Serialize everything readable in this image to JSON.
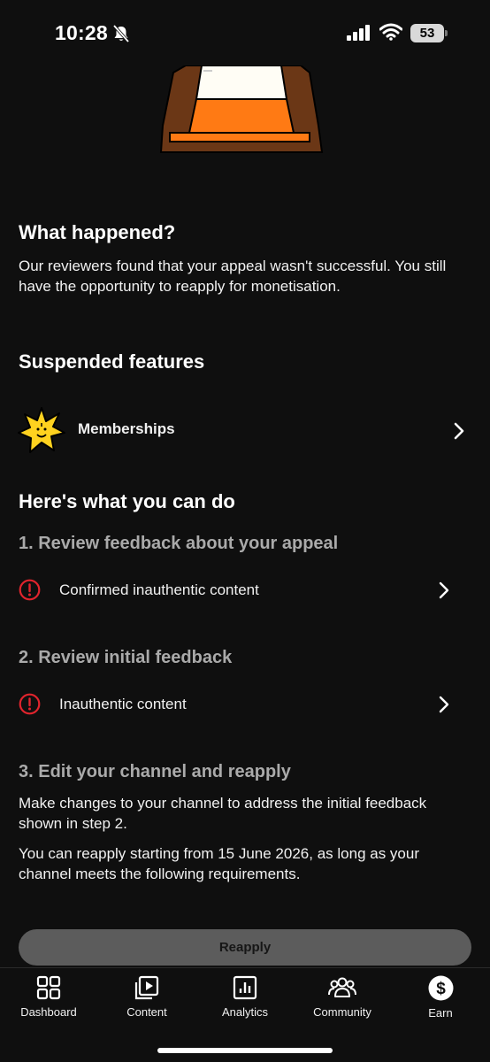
{
  "status_bar": {
    "time": "10:28",
    "battery": "53"
  },
  "what_happened": {
    "heading": "What happened?",
    "body": "Our reviewers found that your appeal wasn't successful. You still have the opportunity to reapply for monetisation."
  },
  "suspended": {
    "heading": "Suspended features",
    "items": [
      {
        "label": "Memberships"
      }
    ]
  },
  "what_you_can_do": {
    "heading": "Here's what you can do",
    "step1": {
      "title": "1. Review feedback about your appeal",
      "item": "Confirmed inauthentic content"
    },
    "step2": {
      "title": "2. Review initial feedback",
      "item": "Inauthentic content"
    },
    "step3": {
      "title": "3. Edit your channel and reapply",
      "paragraph1": "Make changes to your channel to address the initial feedback shown in step 2.",
      "paragraph2": "You can reapply starting from 15 June 2026, as long as your channel meets the following requirements."
    }
  },
  "reapply_button": "Reapply",
  "nav": {
    "items": [
      {
        "label": "Dashboard",
        "icon": "dashboard-icon"
      },
      {
        "label": "Content",
        "icon": "content-icon"
      },
      {
        "label": "Analytics",
        "icon": "analytics-icon"
      },
      {
        "label": "Community",
        "icon": "community-icon"
      },
      {
        "label": "Earn",
        "icon": "earn-icon"
      }
    ]
  },
  "colors": {
    "background": "#0f0f0f",
    "alert": "#e0242d",
    "button": "#5c5c5c",
    "muted": "#aaaaaa"
  }
}
